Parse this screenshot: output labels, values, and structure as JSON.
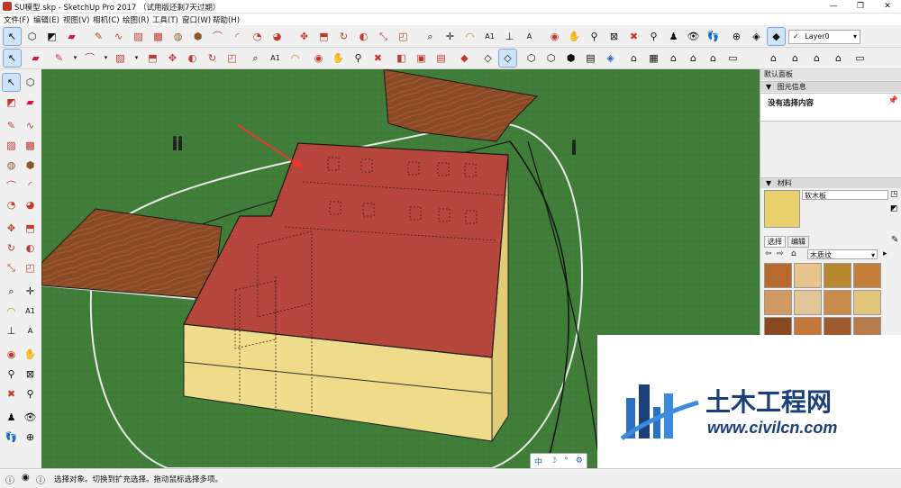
{
  "window": {
    "title": "SU模型.skp - SketchUp Pro 2017 （试用版还剩7天过期）",
    "minimize": "—",
    "maximize": "❐",
    "close": "✕"
  },
  "menu": [
    "文件(F)",
    "编辑(E)",
    "视图(V)",
    "相机(C)",
    "绘图(R)",
    "工具(T)",
    "窗口(W)",
    "帮助(H)"
  ],
  "toolbar": {
    "layer_value": "Layer0",
    "icons_row1": [
      "select-icon",
      "make-component-icon",
      "paint-bucket-icon",
      "eraser-icon",
      "pencil-icon",
      "line-icon",
      "rectangle-icon",
      "rotated-rectangle-icon",
      "circle-icon",
      "polygon-icon",
      "arc-icon",
      "two-point-arc-icon",
      "pie-icon",
      "move-icon",
      "rotate-icon",
      "scale-icon",
      "push-pull-icon",
      "follow-me-icon",
      "offset-icon",
      "tape-measure-icon",
      "dimension-icon",
      "protractor-icon",
      "text-icon",
      "axes-icon",
      "3d-text-icon",
      "orbit-icon",
      "pan-icon",
      "zoom-icon",
      "zoom-window-icon",
      "zoom-extents-icon",
      "previous-view-icon",
      "position-camera-icon",
      "look-around-icon",
      "walk-icon",
      "section-plane-icon",
      "display-section-icon",
      "section-fill-icon"
    ],
    "icons_row2": [
      "select-icon",
      "eraser-icon",
      "pencil-icon",
      "arc-icon",
      "push-pull-icon",
      "move-icon",
      "rotate-icon",
      "offset-icon",
      "tape-measure-icon",
      "text-icon",
      "orbit-icon",
      "pan-icon",
      "zoom-icon",
      "zoom-extents-icon",
      "3d-warehouse-icon",
      "extension-warehouse-icon",
      "layout-icon",
      "xray-icon",
      "back-edges-icon",
      "wireframe-icon",
      "hidden-line-icon",
      "shaded-icon",
      "shaded-textures-icon",
      "monochrome-icon",
      "iso-view-icon",
      "top-view-icon",
      "front-view-icon",
      "right-view-icon",
      "back-view-icon",
      "left-view-icon",
      "shadow-icon"
    ]
  },
  "tray": {
    "title": "默认面板",
    "entity_info": {
      "header": "图元信息",
      "value": "没有选择内容"
    },
    "materials": {
      "header": "材料",
      "name": "软木板",
      "tab_select": "选择",
      "tab_edit": "编辑",
      "collection": "木质纹",
      "swatches": [
        "#b86a2f",
        "#e7c48b",
        "#b8892e",
        "#c57f3b",
        "#d39962",
        "#e2c599",
        "#c98a4a",
        "#e2c77b",
        "#8a4a21",
        "#c3773a",
        "#9c5a2e",
        "#b87c4c"
      ],
      "colors": {
        "preview": "#e8cf6b"
      }
    }
  },
  "status": {
    "message": "选择对象。切换到扩充选择。拖动鼠标选择多项。"
  },
  "mini_controls": [
    "中",
    "☽",
    "°",
    "⚙"
  ],
  "watermark": {
    "text": "土木工程网",
    "url": "www.civilcn.com"
  },
  "colors": {
    "ground": "#3f7d38",
    "roof": "#b7463d",
    "wall": "#eedc8a",
    "wood": "#8b4a26",
    "accent": "#1b3f7b"
  }
}
